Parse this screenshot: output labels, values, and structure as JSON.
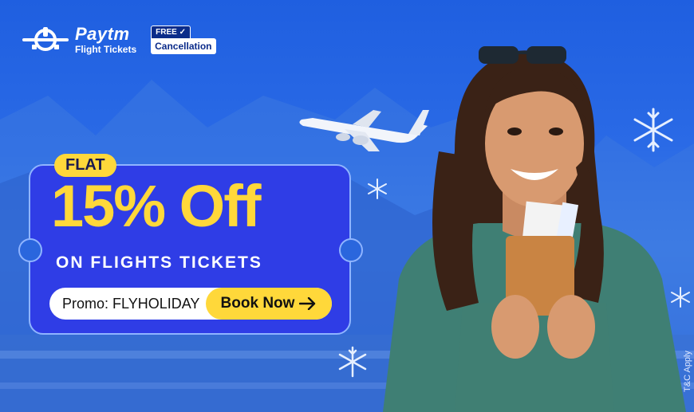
{
  "brand": {
    "name": "Paytm",
    "subtitle": "Flight Tickets",
    "icon": "plane-icon"
  },
  "badge": {
    "top": "FREE ✓",
    "bottom": "Cancellation"
  },
  "offer": {
    "flat": "FLAT",
    "headline": "15% Off",
    "subline": "ON FLIGHTS TICKETS"
  },
  "promo": {
    "label": "Promo: FLYHOLIDAY",
    "button": "Book Now",
    "button_icon": "arrow-right-icon"
  },
  "terms": "T&C Apply",
  "colors": {
    "background": "#2a66dd",
    "ticket": "#2f3de6",
    "accent": "#ffd83a"
  },
  "decor": {
    "snowflake_icon": "snowflake-icon",
    "airplane_image": "airplane-illustration",
    "photo": "woman-holding-passport"
  }
}
